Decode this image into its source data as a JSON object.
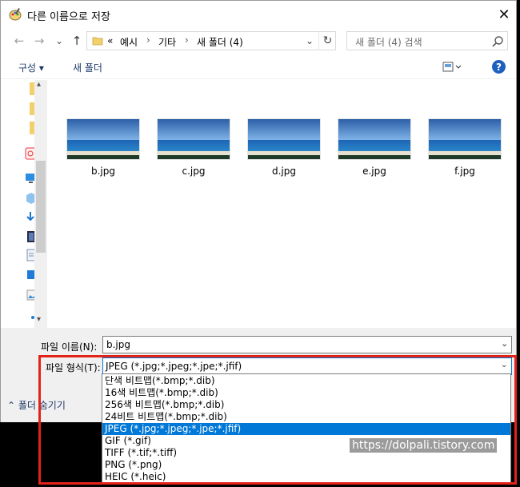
{
  "window": {
    "title": "다른 이름으로 저장",
    "close_label": "✕"
  },
  "nav": {
    "back": "←",
    "forward": "→",
    "dropdown": "⌄",
    "up": "↑"
  },
  "address": {
    "prefix": "«",
    "crumbs": [
      "예시",
      "기타",
      "새 폴더 (4)"
    ],
    "separators": [
      "›",
      "›"
    ],
    "chevron": "⌄",
    "refresh": "↻"
  },
  "search": {
    "placeholder": "새 폴더 (4) 검색"
  },
  "toolbar": {
    "organize": "구성 ▾",
    "new_folder": "새 폴더",
    "help": "?"
  },
  "files": [
    {
      "name": "b.jpg"
    },
    {
      "name": "c.jpg"
    },
    {
      "name": "d.jpg"
    },
    {
      "name": "e.jpg"
    },
    {
      "name": "f.jpg"
    }
  ],
  "filename": {
    "label": "파일 이름(N):",
    "value": "b.jpg",
    "arrow": "⌄"
  },
  "filetype": {
    "label": "파일 형식(T):",
    "value": "JPEG (*.jpg;*.jpeg;*.jpe;*.jfif)",
    "arrow": "⌄"
  },
  "hide_folders": "⌃  폴더 숨기기",
  "filetype_options": [
    "단색 비트맵(*.bmp;*.dib)",
    "16색 비트맵(*.bmp;*.dib)",
    "256색 비트맵(*.bmp;*.dib)",
    "24비트 비트맵(*.bmp;*.dib)",
    "JPEG (*.jpg;*.jpeg;*.jpe;*.jfif)",
    "GIF (*.gif)",
    "TIFF (*.tif;*.tiff)",
    "PNG (*.png)",
    "HEIC (*.heic)"
  ],
  "selected_option_index": 4,
  "watermark": "https://dolpali.tistory.com",
  "colors": {
    "accent": "#0078d7",
    "highlight_box": "#e2231a"
  }
}
